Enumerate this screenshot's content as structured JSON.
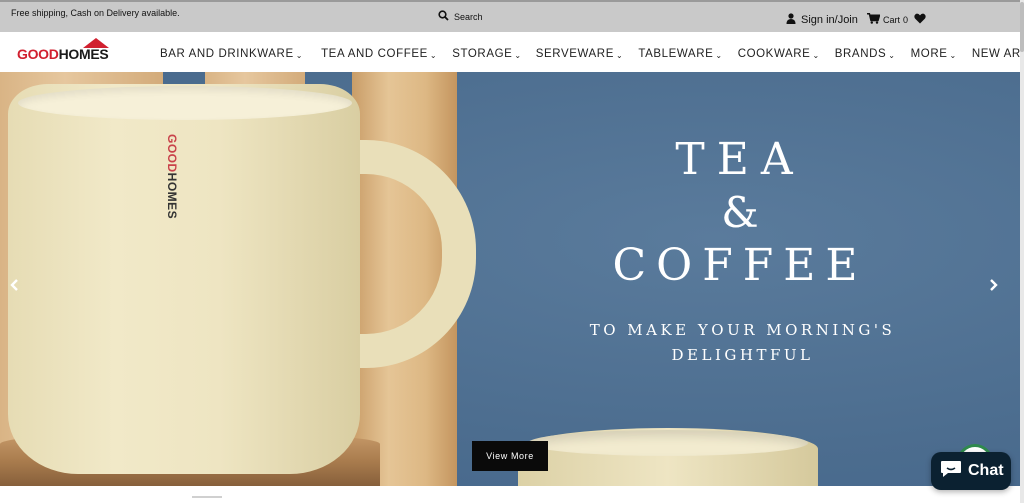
{
  "topbar": {
    "shipping_text": "Free shipping, Cash on Delivery available.",
    "search_label": "Search",
    "signin_label": "Sign in/Join",
    "cart_label": "Cart",
    "cart_count": "0"
  },
  "brand": {
    "logo_good": "GOOD",
    "logo_homes": "HOMES",
    "accent_color": "#d1202f"
  },
  "nav": {
    "items": [
      {
        "label": "BAR AND DRINKWARE",
        "has_dropdown": true
      },
      {
        "label": "TEA AND COFFEE",
        "has_dropdown": true
      },
      {
        "label": "STORAGE",
        "has_dropdown": true
      },
      {
        "label": "SERVEWARE",
        "has_dropdown": true
      },
      {
        "label": "TABLEWARE",
        "has_dropdown": true
      },
      {
        "label": "COOKWARE",
        "has_dropdown": true
      },
      {
        "label": "BRANDS",
        "has_dropdown": true
      },
      {
        "label": "MORE",
        "has_dropdown": true
      },
      {
        "label": "NEW ARRIVALS",
        "has_dropdown": false
      }
    ],
    "caret": "⌄"
  },
  "hero": {
    "title_line1": "TEA",
    "title_line2": "&",
    "title_line3": "COFFEE",
    "subtitle": "TO MAKE YOUR MORNING'S DELIGHTFUL",
    "cta_label": "View More",
    "mug_logo_good": "GOOD",
    "mug_logo_homes": "HOMES",
    "bg_color": "#4f7193"
  },
  "chat": {
    "label": "Chat",
    "bg_color": "#0b2131"
  },
  "icons": {
    "search": "search-icon",
    "user": "user-icon",
    "cart": "cart-icon",
    "wishlist": "heart-icon",
    "prev": "chevron-left-icon",
    "next": "chevron-right-icon",
    "chat": "chat-bubble-icon"
  }
}
